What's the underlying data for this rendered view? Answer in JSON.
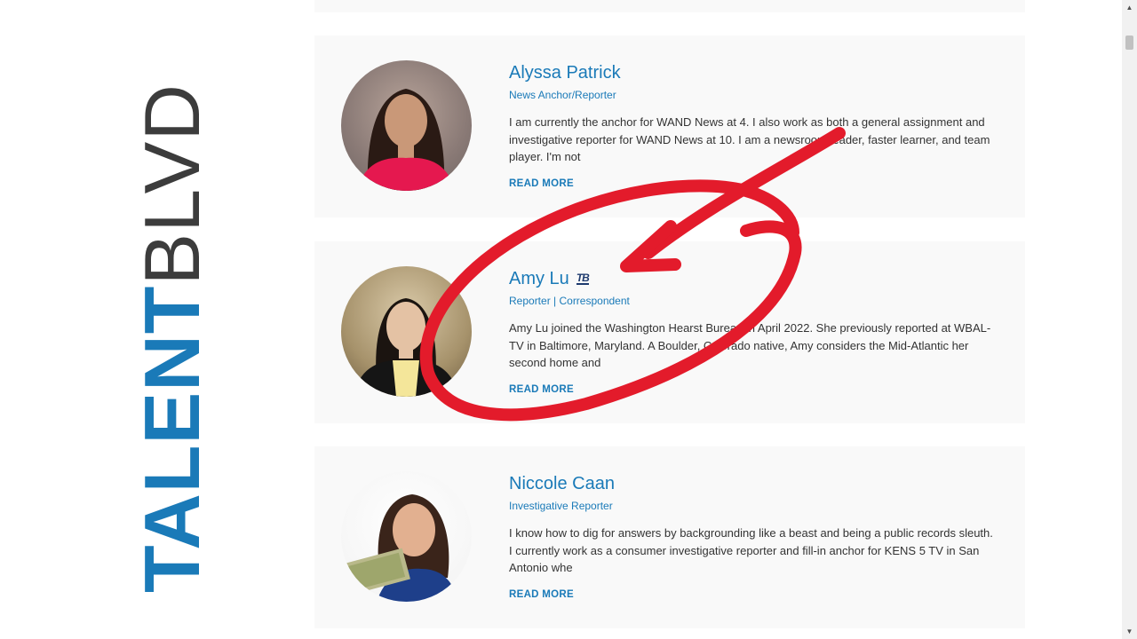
{
  "brand": {
    "talent": "TALENT",
    "blvd": "BLVD"
  },
  "profiles": [
    {
      "name": "Alyssa Patrick",
      "role": "News Anchor/Reporter",
      "bio": "I am currently the anchor for WAND News at 4. I also work as both a general assignment and investigative reporter for WAND News at 10. I am a newsroom leader, faster learner, and team player. I'm not",
      "read_more": "READ MORE"
    },
    {
      "name": "Amy Lu",
      "badge": "TB",
      "role": "Reporter | Correspondent",
      "bio": "Amy Lu joined the Washington Hearst Bureau in April 2022. She previously reported at WBAL-TV in Baltimore, Maryland. A Boulder, Colorado native, Amy considers the Mid-Atlantic her second home and",
      "read_more": "READ MORE"
    },
    {
      "name": "Niccole Caan",
      "role": "Investigative Reporter",
      "bio": "I know how to dig for answers by backgrounding like a beast and being a public records sleuth. I currently work as a consumer investigative reporter and fill-in anchor for KENS 5 TV in San Antonio whe",
      "read_more": "READ MORE"
    }
  ],
  "colors": {
    "accent": "#1a7ab8",
    "annotation": "#e31b2b"
  },
  "icons": {
    "scroll_up": "triangle-up-icon",
    "scroll_down": "triangle-down-icon"
  }
}
